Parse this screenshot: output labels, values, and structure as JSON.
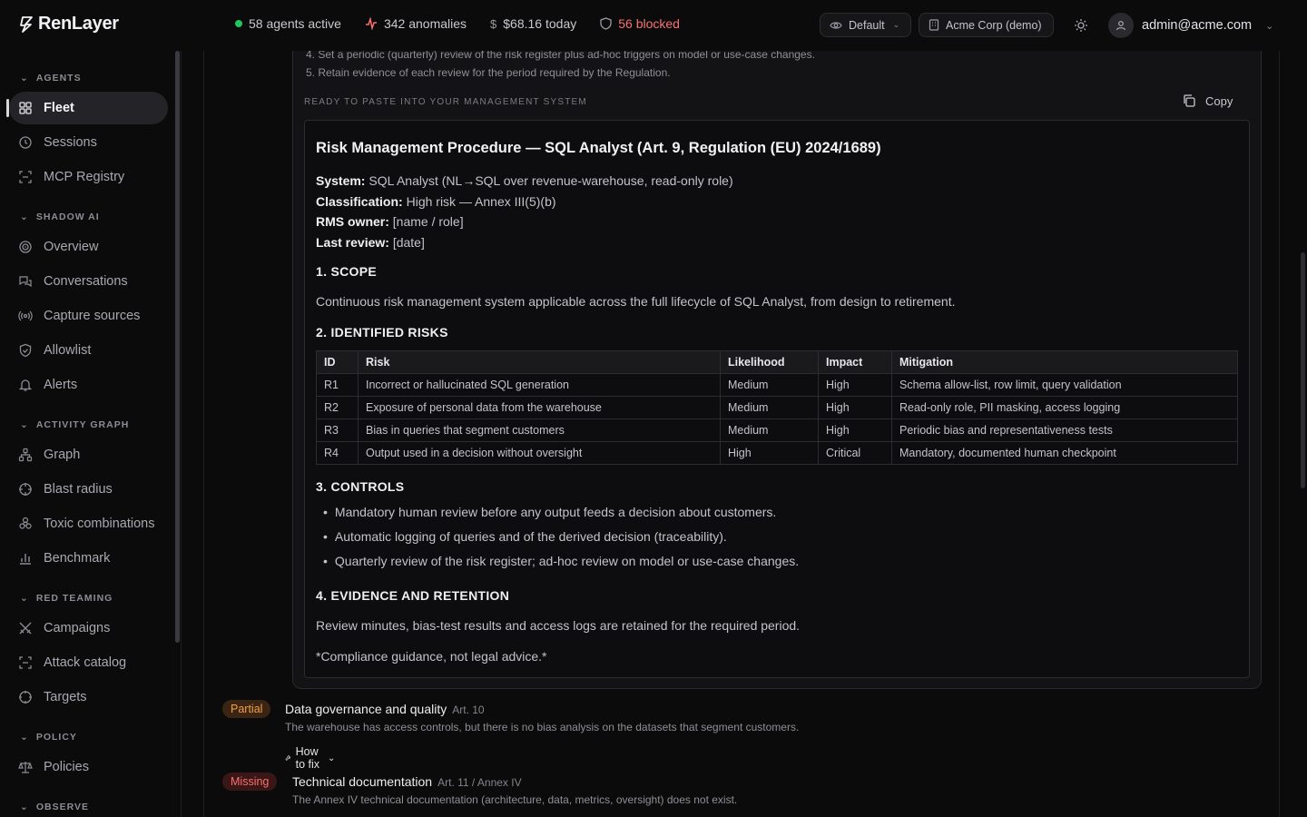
{
  "brand": {
    "name": "RenLayer"
  },
  "topbar": {
    "agents_active": "58 agents active",
    "anomalies": "342 anomalies",
    "cost_today": "$68.16 today",
    "blocked": "56 blocked",
    "view_select": "Default",
    "org_select": "Acme Corp (demo)",
    "user_email": "admin@acme.com"
  },
  "sidebar": {
    "agents": {
      "label": "AGENTS",
      "items": [
        "Fleet",
        "Sessions",
        "MCP Registry"
      ]
    },
    "shadow_ai": {
      "label": "SHADOW AI",
      "items": [
        "Overview",
        "Conversations",
        "Capture sources",
        "Allowlist",
        "Alerts"
      ]
    },
    "activity_graph": {
      "label": "ACTIVITY GRAPH",
      "items": [
        "Graph",
        "Blast radius",
        "Toxic combinations",
        "Benchmark"
      ]
    },
    "red_teaming": {
      "label": "RED TEAMING",
      "items": [
        "Campaigns",
        "Attack catalog",
        "Targets"
      ]
    },
    "policy": {
      "label": "POLICY",
      "items": [
        "Policies"
      ]
    },
    "observe": {
      "label": "OBSERVE"
    }
  },
  "guidance": {
    "step4": "4. Set a periodic (quarterly) review of the risk register plus ad-hoc triggers on model or use-case changes.",
    "step5": "5. Retain evidence of each review for the period required by the Regulation.",
    "ready_label": "READY TO PASTE INTO YOUR MANAGEMENT SYSTEM",
    "copy_label": "Copy"
  },
  "doc": {
    "title": "Risk Management Procedure — SQL Analyst (Art. 9, Regulation (EU) 2024/1689)",
    "system_label": "System:",
    "system_value": "SQL Analyst (NL→SQL over revenue-warehouse, read-only role)",
    "class_label": "Classification:",
    "class_value": "High risk — Annex III(5)(b)",
    "owner_label": "RMS owner:",
    "owner_value": "[name / role]",
    "review_label": "Last review:",
    "review_value": "[date]",
    "scope_heading": "1. SCOPE",
    "scope_text": "Continuous risk management system applicable across the full lifecycle of SQL Analyst, from design to retirement.",
    "risks_heading": "2. IDENTIFIED RISKS",
    "table": {
      "headers": [
        "ID",
        "Risk",
        "Likelihood",
        "Impact",
        "Mitigation"
      ],
      "rows": [
        [
          "R1",
          "Incorrect or hallucinated SQL generation",
          "Medium",
          "High",
          "Schema allow-list, row limit, query validation"
        ],
        [
          "R2",
          "Exposure of personal data from the warehouse",
          "Medium",
          "High",
          "Read-only role, PII masking, access logging"
        ],
        [
          "R3",
          "Bias in queries that segment customers",
          "Medium",
          "High",
          "Periodic bias and representativeness tests"
        ],
        [
          "R4",
          "Output used in a decision without oversight",
          "High",
          "Critical",
          "Mandatory, documented human checkpoint"
        ]
      ]
    },
    "controls_heading": "3. CONTROLS",
    "controls": [
      "Mandatory human review before any output feeds a decision about customers.",
      "Automatic logging of queries and of the derived decision (traceability).",
      "Quarterly review of the risk register; ad-hoc review on model or use-case changes."
    ],
    "evidence_heading": "4. EVIDENCE AND RETENTION",
    "evidence_text": "Review minutes, bias-test results and access logs are retained for the required period.",
    "disclaimer": "*Compliance guidance, not legal advice.*"
  },
  "requirements": [
    {
      "status": "Partial",
      "title": "Data governance and quality",
      "article": "Art. 10",
      "description": "The warehouse has access controls, but there is no bias analysis on the datasets that segment customers.",
      "fix_label": "How to fix"
    },
    {
      "status": "Missing",
      "title": "Technical documentation",
      "article": "Art. 11 / Annex IV",
      "description": "The Annex IV technical documentation (architecture, data, metrics, oversight) does not exist."
    }
  ]
}
